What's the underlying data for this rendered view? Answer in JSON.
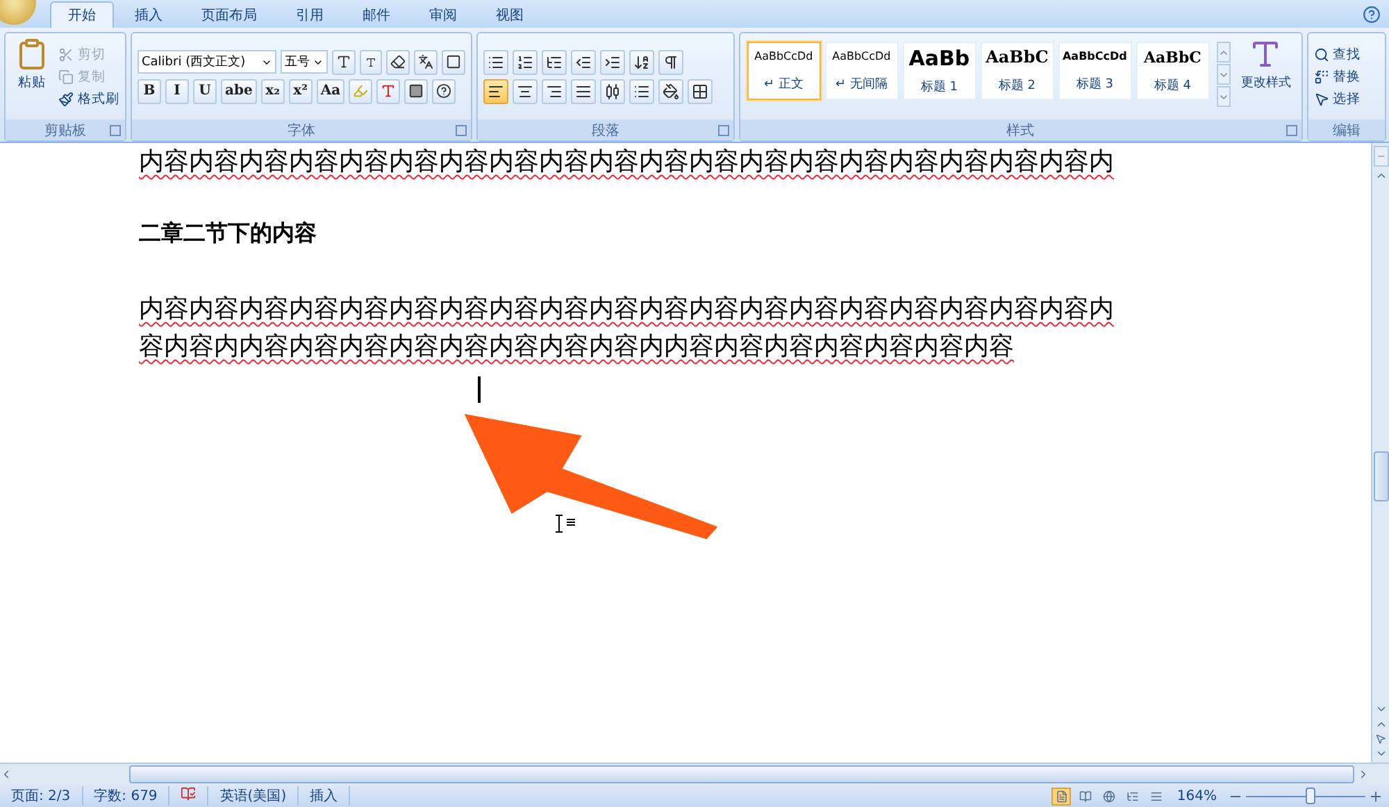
{
  "tabs": [
    {
      "label": "开始",
      "selected": true
    },
    {
      "label": "插入",
      "selected": false
    },
    {
      "label": "页面布局",
      "selected": false
    },
    {
      "label": "引用",
      "selected": false
    },
    {
      "label": "邮件",
      "selected": false
    },
    {
      "label": "审阅",
      "selected": false
    },
    {
      "label": "视图",
      "selected": false
    }
  ],
  "clipboard": {
    "group": "剪贴板",
    "paste": "粘贴",
    "actions": [
      {
        "label": "剪切",
        "kind": "cut",
        "disabled": true
      },
      {
        "label": "复制",
        "kind": "copy",
        "disabled": true
      },
      {
        "label": "格式刷",
        "kind": "painter",
        "disabled": false
      }
    ]
  },
  "font": {
    "group": "字体",
    "name": "Calibri (西文正文)",
    "size": "五号",
    "format_buttons": [
      "B",
      "I",
      "U",
      "abe",
      "x₂",
      "x²",
      "Aa"
    ]
  },
  "paragraph": {
    "group": "段落",
    "alignment": [
      {
        "kind": "left",
        "selected": true
      },
      {
        "kind": "center",
        "selected": false
      },
      {
        "kind": "right",
        "selected": false
      },
      {
        "kind": "justify",
        "selected": false
      },
      {
        "kind": "distributed",
        "selected": false
      }
    ]
  },
  "styles": {
    "group": "样式",
    "change": "更改样式",
    "items": [
      {
        "preview": "AaBbCcDd",
        "label": "↵ 正文",
        "kind": "body",
        "selected": true
      },
      {
        "preview": "AaBbCcDd",
        "label": "↵ 无间隔",
        "kind": "body",
        "selected": false
      },
      {
        "preview": "AaBb",
        "label": "标题 1",
        "kind": "h1",
        "selected": false
      },
      {
        "preview": "AaBbC",
        "label": "标题 2",
        "kind": "h2",
        "selected": false
      },
      {
        "preview": "AaBbCcDd",
        "label": "标题 3",
        "kind": "h3",
        "selected": false
      },
      {
        "preview": "AaBbC",
        "label": "标题 4",
        "kind": "h4",
        "selected": false
      }
    ]
  },
  "editing": {
    "group": "编辑",
    "actions": [
      {
        "label": "查找",
        "kind": "find"
      },
      {
        "label": "替换",
        "kind": "replace"
      },
      {
        "label": "选择",
        "kind": "select"
      }
    ]
  },
  "document": {
    "top_line": "内容内容内容内容内容内容内容内容内容内容内容内容内容内容内容内容内容内容内容内",
    "heading": "二章二节下的内容",
    "paragraph": [
      "内容内容内容内容内容内容内容内容内容内容内容内容内容内容内容内容内容内容内容内",
      "容内容内内容内容内容内容内容内容内容内容内内容内容内容内容内容内容内容"
    ]
  },
  "status_bar": {
    "page": "页面: 2/3",
    "words": "字数: 679",
    "language": "英语(美国)",
    "mode": "插入",
    "views": [
      {
        "selected": true
      },
      {
        "selected": false
      },
      {
        "selected": false
      },
      {
        "selected": false
      },
      {
        "selected": false
      }
    ],
    "zoom": "164%",
    "zoom_slider": {
      "level": 0.55
    }
  }
}
